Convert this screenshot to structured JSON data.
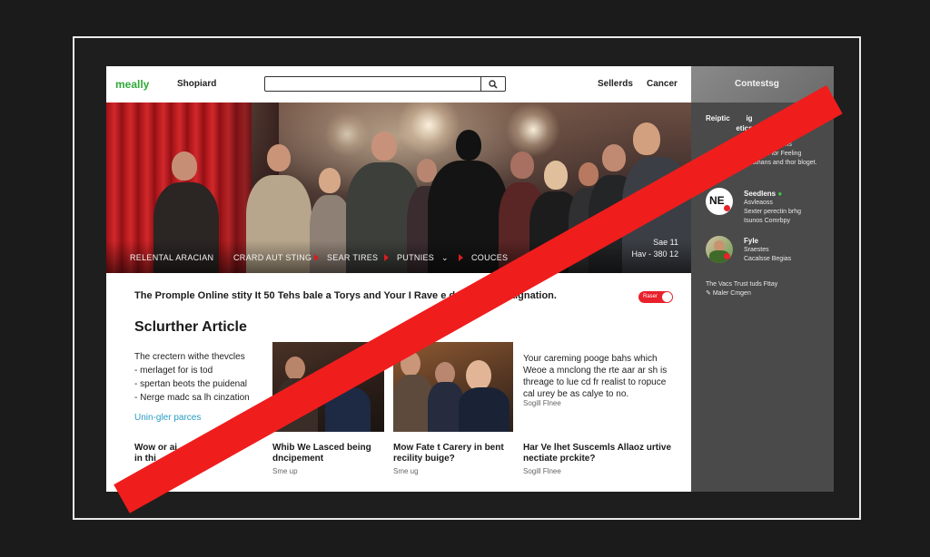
{
  "header": {
    "logo": "meally",
    "shop_label": "Shopiard",
    "search_placeholder": "",
    "nav": [
      "Sellerds",
      "Cancer"
    ]
  },
  "hero": {
    "menu": [
      "RELENTAL ARACIAN",
      "CRARD AUT STING",
      "SEAR TIRES",
      "PUTNIES",
      "COUCES"
    ],
    "date_line1": "Sae 11",
    "date_line2": "Hav - 380 12"
  },
  "main": {
    "headline": "The Promple Online stity It 50 Tehs bale a Torys and Your I Rave         e dsst frot boyaignation.",
    "toggle_label": "Raser",
    "section_title": "Sclurther Article",
    "list": [
      "The crectern withe thevcles",
      "- merlaget for is tod",
      "- spertan beots the puidenal",
      "- Nerge madc sa lh cinzation"
    ],
    "learn_link": "Unin-gler parces",
    "description": "Your careming pooge bahs which Weoe a mnclong the rte aar ar sh is threage to lue cd fr realist to ropuce cal urey be as calye to no.",
    "description_sub": "Sogill Flnee",
    "cards": [
      {
        "title_line1": "Wow or ai",
        "title_line2": "in thi               you.",
        "sub": ""
      },
      {
        "title_line1": "Whib We Lasced being",
        "title_line2": "dncipement",
        "sub": "Sme up"
      },
      {
        "title_line1": "Mow Fate t Carery in bent",
        "title_line2": "recility buige?",
        "sub": "Sme ug"
      },
      {
        "title_line1": "Har Ve lhet Suscemls Allaoz urtive",
        "title_line2": "nectiate prckite?",
        "sub": "Sogill Flnee"
      }
    ]
  },
  "sidebar": {
    "title": "Contestsg",
    "block1_title": "Reiptic        ig",
    "block1_title2": "               etics",
    "block1_lines": [
      "Sucdecited btlins",
      "Phyestlal for Feeling",
      "Ruothans and thor bloget."
    ],
    "user1_name": "Seedlens",
    "user1_lines": [
      "Asvleaoss",
      "Sexter perectin brhg",
      "Isunos Comrbpy"
    ],
    "avatar1_text": "NE",
    "user2_name": "Fyle",
    "user2_lines": [
      "Sraestes",
      "Cacalsse Begias"
    ],
    "foot_lines": [
      "The Vacs Trust tuds Fttay",
      "Maler Cmgen"
    ]
  },
  "colors": {
    "accent": "#e8212b",
    "logo": "#2fa93a",
    "link": "#2a9cc4",
    "sidebar_bg": "#4a4a4a",
    "slash": "#f01d1d"
  }
}
